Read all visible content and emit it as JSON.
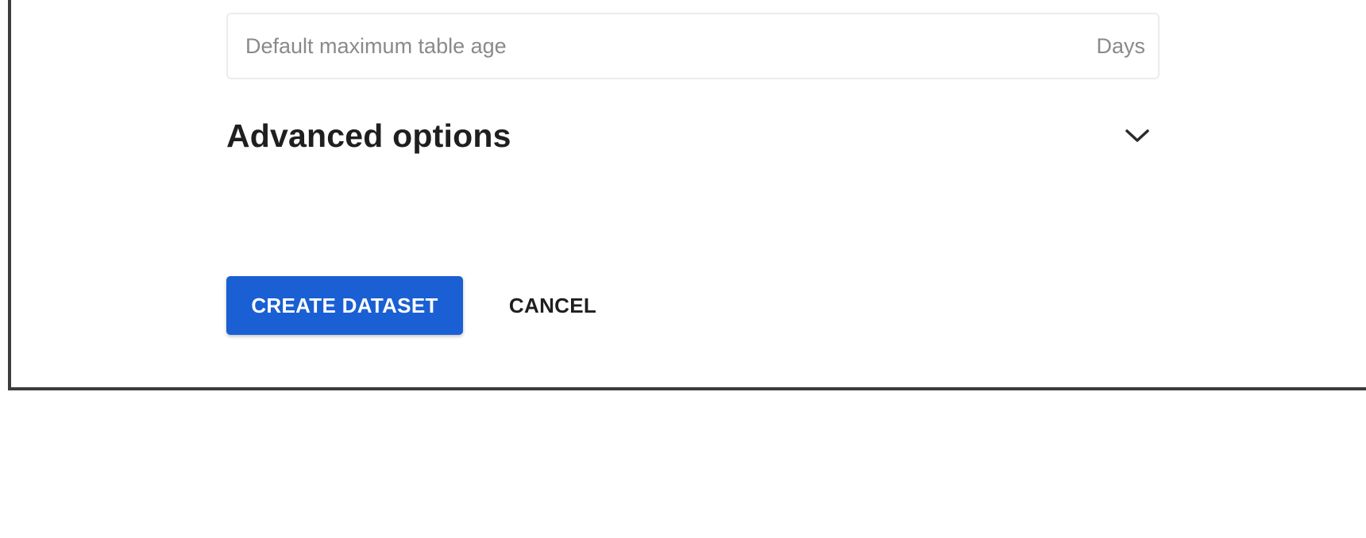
{
  "form": {
    "table_age_field": {
      "placeholder": "Default maximum table age",
      "suffix": "Days",
      "value": ""
    },
    "advanced_options": {
      "title": "Advanced options",
      "icon": "chevron-down-icon",
      "expanded": false
    },
    "actions": {
      "create_label": "CREATE DATASET",
      "cancel_label": "CANCEL"
    }
  },
  "colors": {
    "primary": "#1a5fd3",
    "text": "#1f1f1f",
    "placeholder": "#8a8a8a",
    "frame_border": "#3c3c3c"
  }
}
